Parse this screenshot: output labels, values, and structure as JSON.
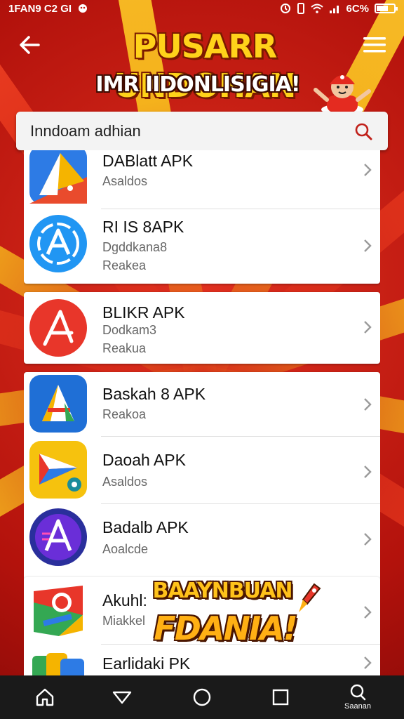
{
  "status_bar": {
    "left_text": "1FAN9 C2 GI",
    "battery_text": "6C%"
  },
  "header": {
    "title": "PUSARR UNDOHAN",
    "subtitle": "IMR IIDONLISIGIA!"
  },
  "search": {
    "value": "Inndoam adhian"
  },
  "apps": [
    {
      "name": "DABlatt APK",
      "line1": "Asaldos",
      "line2": ""
    },
    {
      "name": "RI IS 8APK",
      "line1": "Dgddkana8",
      "line2": "Reakea"
    },
    {
      "name": "BLIKR APK",
      "line1": "Dodkam3",
      "line2": "Reakua"
    },
    {
      "name": "Baskah 8 APK",
      "line1": "Reakoa",
      "line2": ""
    },
    {
      "name": "Daoah APK",
      "line1": "Asaldos",
      "line2": ""
    },
    {
      "name": "Badalb APK",
      "line1": "Aoalcde",
      "line2": ""
    },
    {
      "name": "Akuhl:",
      "line1": "Miakkel",
      "line2": ""
    },
    {
      "name": "Earlidaki PK",
      "line1": "",
      "line2": ""
    }
  ],
  "promo": {
    "line1": "BAAYNBUAN",
    "line2": "FDANIA!"
  },
  "nav": {
    "account_label": "Saanan"
  },
  "colors": {
    "brand_red": "#c8160f",
    "accent_yellow": "#ffd21a",
    "search_icon": "#c0201a"
  }
}
